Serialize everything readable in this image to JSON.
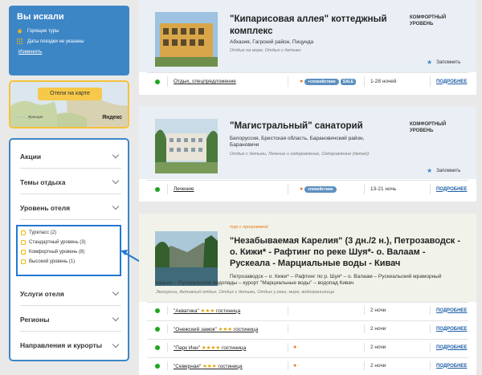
{
  "search": {
    "title": "Вы искали",
    "items": [
      {
        "icon": "fire-icon",
        "text": "Горящие туры"
      },
      {
        "icon": "calendar-icon",
        "text": "Даты поездки не указаны"
      }
    ],
    "change_link": "Изменить"
  },
  "map": {
    "button": "Отели на карте",
    "city": "Франция",
    "brand": "Яндекс"
  },
  "filters": {
    "items": [
      "Акции",
      "Темы отдыха",
      "Уровень отеля",
      "Услуги отеля",
      "Регионы",
      "Направления и курорты"
    ],
    "levels": [
      "Туркласс (2)",
      "Стандартный уровень (3)",
      "Комфортный уровень (8)",
      "Высокий уровень (1)"
    ]
  },
  "cards": [
    {
      "title_line1": "\"Кипарисовая аллея\" коттеджный",
      "title_line2": "комплекс",
      "location": "Абхазия, Гагрский район, Пицунда",
      "tags": "Отдых на море, Отдых с детьми",
      "level_line1": "КОМФОРТНЫЙ",
      "level_line2": "УРОВЕНЬ",
      "remember": "Запомнить",
      "rows": [
        {
          "name": "Отдых, спецпредложение",
          "badges": [
            "+спокойствие",
            "SALE"
          ],
          "nights": "1-28 ночей",
          "more": "ПОДРОБНЕЕ"
        }
      ]
    },
    {
      "title_line1": "\"Магистральный\" санаторий",
      "location_line1": "Белоруссия, Брестская область, Барановичский район,",
      "location_line2": "Барановичи",
      "tags": "Отдых с детьми, Лечение и оздоровление, Оздоровление (детей)",
      "level_line1": "КОМФОРТНЫЙ",
      "level_line2": "УРОВЕНЬ",
      "remember": "Запомнить",
      "rows": [
        {
          "name": "Лечение",
          "badges": [
            "спокойствие"
          ],
          "nights": "13-21 ночь",
          "more": "ПОДРОБНЕЕ"
        }
      ]
    },
    {
      "promo": "тур с программой",
      "title_line1": "\"Незабываемая Карелия\" (3 дн./2 н.), Петрозаводск -",
      "title_line2": "о. Кижи* - Рафтинг по реке Шуя*- о. Валаам -",
      "title_line3": "Рускеала - Марциальные воды - Кивач",
      "desc_line1": "Петрозаводск – о. Кижи* – Рафтинг по р. Шуя* – о. Валаам – Рускеальский мраморный",
      "desc_line2": "каньон – Рускеальские водопады – курорт \"Марциальные воды\" – водопад Кивач",
      "tags": "Экскурсии, Активный отдых, Отдых с детьми, Отдых у реки, моря, водохранилища",
      "rows": [
        {
          "name": "\"Акватика\"",
          "stars": "★★★",
          "suffix": "гостиница",
          "nights": "2 ночи",
          "more": "ПОДРОБНЕЕ",
          "fire": false
        },
        {
          "name": "\"Онежский замок\"",
          "stars": "★★★",
          "suffix": "гостиница",
          "nights": "2 ночи",
          "more": "ПОДРОБНЕЕ",
          "fire": false
        },
        {
          "name": "\"Парк Инн\"",
          "stars": "★★★★",
          "suffix": "гостиница",
          "nights": "2 ночи",
          "more": "ПОДРОБНЕЕ",
          "fire": true
        },
        {
          "name": "\"Северная\"",
          "stars": "★★★",
          "suffix": "гостиница",
          "nights": "2 ночи",
          "more": "ПОДРОБНЕЕ",
          "fire": true
        }
      ]
    }
  ],
  "colors": {
    "accent": "#3d86c6",
    "highlight": "#2278d2",
    "badge": "#f4c23c"
  }
}
